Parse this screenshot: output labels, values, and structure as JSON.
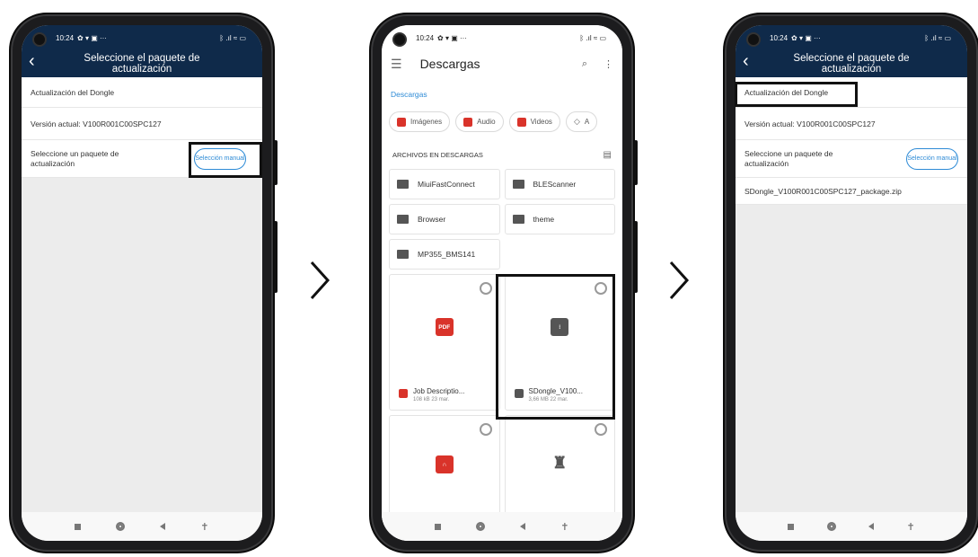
{
  "colors": {
    "header_bg": "#0f2a4a",
    "accent": "#2e8bd6",
    "pdf_red": "#d9332a",
    "archive_gray": "#555555"
  },
  "status": {
    "time": "10:24",
    "icons_left": "✿ ▾ ▣ ···",
    "icons_right": "ᛒ .ıl ≈ ▭"
  },
  "screen1": {
    "title": "Seleccione el paquete de actualización",
    "dongle_label": "Actualización del Dongle",
    "version_label": "Versión actual: V100R001C00SPC127",
    "select_label": "Seleccione un paquete de actualización",
    "manual_button": "Selección manual"
  },
  "screen2": {
    "title": "Descargas",
    "breadcrumb": "Descargas",
    "chips": [
      "Imágenes",
      "Audio",
      "Videos",
      "A"
    ],
    "section_title": "ARCHIVOS EN DESCARGAS",
    "folders": [
      "MiuiFastConnect",
      "BLEScanner",
      "Browser",
      "theme",
      "MP355_BMS141"
    ],
    "files": [
      {
        "name": "Job Descriptio...",
        "meta": "108 kB 23 mar.",
        "badge": "PDF"
      },
      {
        "name": "SDongle_V100...",
        "meta": "3,66 MB 22 mar.",
        "badge": "zip"
      }
    ]
  },
  "screen3": {
    "title": "Seleccione el paquete de actualización",
    "dongle_label": "Actualización del Dongle",
    "version_label": "Versión actual: V100R001C00SPC127",
    "select_label": "Seleccione un paquete de actualización",
    "manual_button": "Selección manual",
    "package_file": "SDongle_V100R001C00SPC127_package.zip"
  },
  "nav": {
    "recents": "■",
    "home": "●",
    "back": "◀",
    "assist": "✝"
  }
}
